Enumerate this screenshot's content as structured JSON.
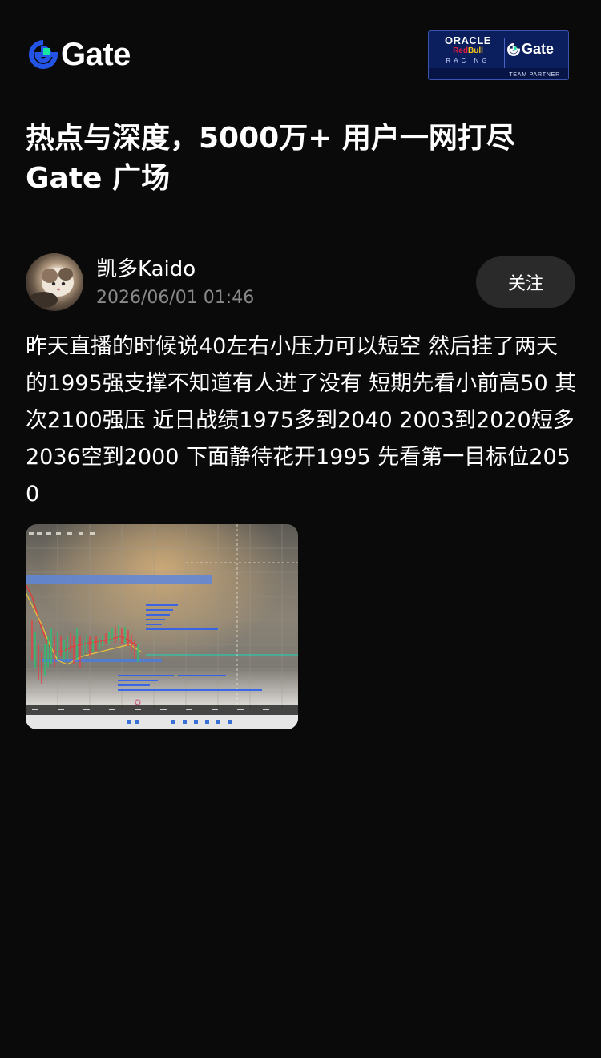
{
  "header": {
    "logo_text": "Gate",
    "partner_badge": {
      "line1": "ORACLE",
      "line2_red": "Red",
      "line2_bull": "Bull",
      "line3": "RACING",
      "brand": "Gate",
      "footer": "TEAM PARTNER"
    }
  },
  "headline": {
    "line1": "热点与深度，5000万+ 用户一网打尽",
    "line2": "Gate 广场"
  },
  "post": {
    "author": "凯多Kaido",
    "timestamp": "2026/06/01 01:46",
    "follow_label": "关注",
    "body": "昨天直播的时候说40左右小压力可以短空 然后挂了两天的1995强支撑不知道有人进了没有 短期先看小前高50 其次2100强压 近日战绩1975多到2040 2003到2020短多 2036空到2000 下面静待花开1995 先看第一目标位2050"
  },
  "colors": {
    "background": "#0a0a0a",
    "accent_blue": "#2354e6",
    "accent_green": "#17e6a1",
    "button_bg": "#2a2a2a",
    "muted_text": "#8a8a8a"
  }
}
